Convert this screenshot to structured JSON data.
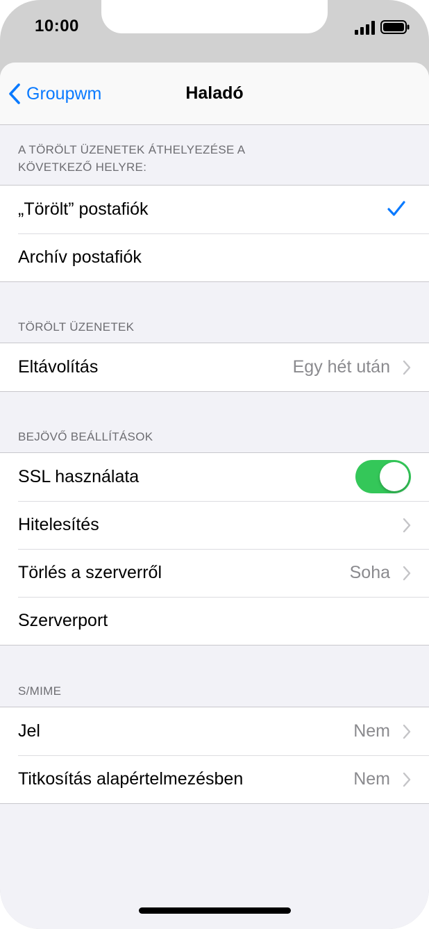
{
  "status_bar": {
    "time": "10:00"
  },
  "nav": {
    "back_label": "Groupwm",
    "title": "Haladó"
  },
  "sections": {
    "move_deleted": {
      "header_line1": "A TÖRÖLT ÜZENETEK ÁTHELYEZÉSE A",
      "header_line2": "KÖVETKEZŐ HELYRE:",
      "options": [
        {
          "label": "„Törölt” postafiók",
          "selected": true
        },
        {
          "label": "Archív postafiók",
          "selected": false
        }
      ]
    },
    "deleted_messages": {
      "header": "TÖRÖLT ÜZENETEK",
      "remove": {
        "label": "Eltávolítás",
        "value": "Egy hét után"
      }
    },
    "incoming": {
      "header": "BEJÖVŐ BEÁLLÍTÁSOK",
      "ssl": {
        "label": "SSL használata",
        "on": true
      },
      "auth": {
        "label": "Hitelesítés"
      },
      "delete_from_server": {
        "label": "Törlés a szerverről",
        "value": "Soha"
      },
      "server_port": {
        "label": "Szerverport"
      }
    },
    "smime": {
      "header": "S/MIME",
      "sign": {
        "label": "Jel",
        "value": "Nem"
      },
      "encrypt": {
        "label": "Titkosítás alapértelmezésben",
        "value": "Nem"
      }
    }
  },
  "colors": {
    "accent": "#0a7aff",
    "toggle_on": "#34c759",
    "secondary_text": "#8a8a8e",
    "background": "#f2f2f7"
  },
  "icons": [
    "back-chevron-icon",
    "checkmark-icon",
    "chevron-right-icon",
    "signal-icon",
    "battery-icon"
  ]
}
